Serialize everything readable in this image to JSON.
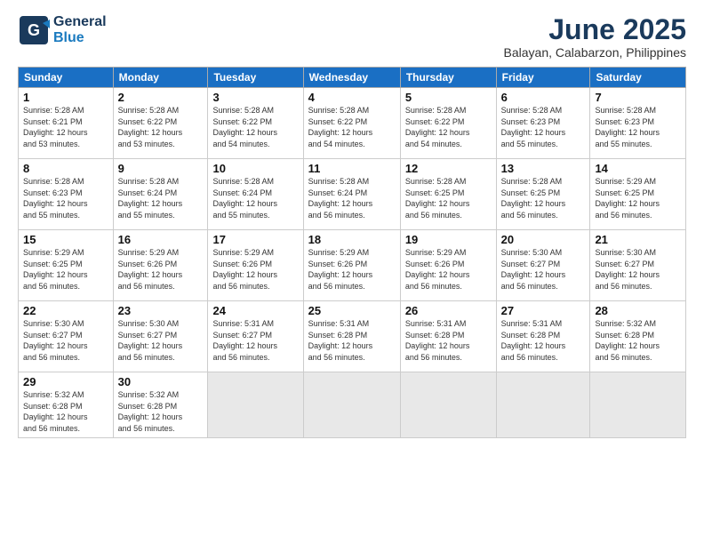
{
  "logo": {
    "line1": "General",
    "line2": "Blue"
  },
  "title": "June 2025",
  "subtitle": "Balayan, Calabarzon, Philippines",
  "weekdays": [
    "Sunday",
    "Monday",
    "Tuesday",
    "Wednesday",
    "Thursday",
    "Friday",
    "Saturday"
  ],
  "weeks": [
    [
      {
        "day": "1",
        "info": "Sunrise: 5:28 AM\nSunset: 6:21 PM\nDaylight: 12 hours\nand 53 minutes."
      },
      {
        "day": "2",
        "info": "Sunrise: 5:28 AM\nSunset: 6:22 PM\nDaylight: 12 hours\nand 53 minutes."
      },
      {
        "day": "3",
        "info": "Sunrise: 5:28 AM\nSunset: 6:22 PM\nDaylight: 12 hours\nand 54 minutes."
      },
      {
        "day": "4",
        "info": "Sunrise: 5:28 AM\nSunset: 6:22 PM\nDaylight: 12 hours\nand 54 minutes."
      },
      {
        "day": "5",
        "info": "Sunrise: 5:28 AM\nSunset: 6:22 PM\nDaylight: 12 hours\nand 54 minutes."
      },
      {
        "day": "6",
        "info": "Sunrise: 5:28 AM\nSunset: 6:23 PM\nDaylight: 12 hours\nand 55 minutes."
      },
      {
        "day": "7",
        "info": "Sunrise: 5:28 AM\nSunset: 6:23 PM\nDaylight: 12 hours\nand 55 minutes."
      }
    ],
    [
      {
        "day": "8",
        "info": "Sunrise: 5:28 AM\nSunset: 6:23 PM\nDaylight: 12 hours\nand 55 minutes."
      },
      {
        "day": "9",
        "info": "Sunrise: 5:28 AM\nSunset: 6:24 PM\nDaylight: 12 hours\nand 55 minutes."
      },
      {
        "day": "10",
        "info": "Sunrise: 5:28 AM\nSunset: 6:24 PM\nDaylight: 12 hours\nand 55 minutes."
      },
      {
        "day": "11",
        "info": "Sunrise: 5:28 AM\nSunset: 6:24 PM\nDaylight: 12 hours\nand 56 minutes."
      },
      {
        "day": "12",
        "info": "Sunrise: 5:28 AM\nSunset: 6:25 PM\nDaylight: 12 hours\nand 56 minutes."
      },
      {
        "day": "13",
        "info": "Sunrise: 5:28 AM\nSunset: 6:25 PM\nDaylight: 12 hours\nand 56 minutes."
      },
      {
        "day": "14",
        "info": "Sunrise: 5:29 AM\nSunset: 6:25 PM\nDaylight: 12 hours\nand 56 minutes."
      }
    ],
    [
      {
        "day": "15",
        "info": "Sunrise: 5:29 AM\nSunset: 6:25 PM\nDaylight: 12 hours\nand 56 minutes."
      },
      {
        "day": "16",
        "info": "Sunrise: 5:29 AM\nSunset: 6:26 PM\nDaylight: 12 hours\nand 56 minutes."
      },
      {
        "day": "17",
        "info": "Sunrise: 5:29 AM\nSunset: 6:26 PM\nDaylight: 12 hours\nand 56 minutes."
      },
      {
        "day": "18",
        "info": "Sunrise: 5:29 AM\nSunset: 6:26 PM\nDaylight: 12 hours\nand 56 minutes."
      },
      {
        "day": "19",
        "info": "Sunrise: 5:29 AM\nSunset: 6:26 PM\nDaylight: 12 hours\nand 56 minutes."
      },
      {
        "day": "20",
        "info": "Sunrise: 5:30 AM\nSunset: 6:27 PM\nDaylight: 12 hours\nand 56 minutes."
      },
      {
        "day": "21",
        "info": "Sunrise: 5:30 AM\nSunset: 6:27 PM\nDaylight: 12 hours\nand 56 minutes."
      }
    ],
    [
      {
        "day": "22",
        "info": "Sunrise: 5:30 AM\nSunset: 6:27 PM\nDaylight: 12 hours\nand 56 minutes."
      },
      {
        "day": "23",
        "info": "Sunrise: 5:30 AM\nSunset: 6:27 PM\nDaylight: 12 hours\nand 56 minutes."
      },
      {
        "day": "24",
        "info": "Sunrise: 5:31 AM\nSunset: 6:27 PM\nDaylight: 12 hours\nand 56 minutes."
      },
      {
        "day": "25",
        "info": "Sunrise: 5:31 AM\nSunset: 6:28 PM\nDaylight: 12 hours\nand 56 minutes."
      },
      {
        "day": "26",
        "info": "Sunrise: 5:31 AM\nSunset: 6:28 PM\nDaylight: 12 hours\nand 56 minutes."
      },
      {
        "day": "27",
        "info": "Sunrise: 5:31 AM\nSunset: 6:28 PM\nDaylight: 12 hours\nand 56 minutes."
      },
      {
        "day": "28",
        "info": "Sunrise: 5:32 AM\nSunset: 6:28 PM\nDaylight: 12 hours\nand 56 minutes."
      }
    ],
    [
      {
        "day": "29",
        "info": "Sunrise: 5:32 AM\nSunset: 6:28 PM\nDaylight: 12 hours\nand 56 minutes."
      },
      {
        "day": "30",
        "info": "Sunrise: 5:32 AM\nSunset: 6:28 PM\nDaylight: 12 hours\nand 56 minutes."
      },
      {
        "day": "",
        "info": ""
      },
      {
        "day": "",
        "info": ""
      },
      {
        "day": "",
        "info": ""
      },
      {
        "day": "",
        "info": ""
      },
      {
        "day": "",
        "info": ""
      }
    ]
  ]
}
